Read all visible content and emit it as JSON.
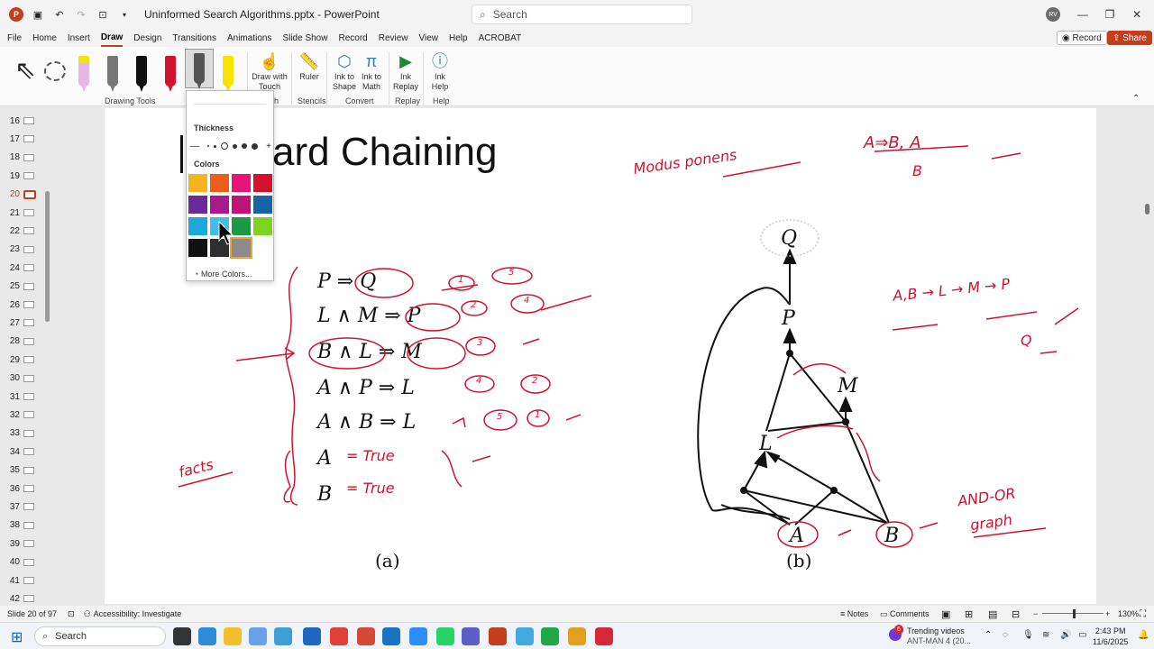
{
  "window": {
    "app_logo": "P",
    "title": "Uninformed Search Algorithms.pptx  -  PowerPoint",
    "search_placeholder": "Search",
    "user_initials": "RV"
  },
  "menu": {
    "tabs": [
      "File",
      "Home",
      "Insert",
      "Draw",
      "Design",
      "Transitions",
      "Animations",
      "Slide Show",
      "Record",
      "Review",
      "View",
      "Help",
      "ACROBAT"
    ],
    "active": "Draw",
    "record_label": "Record",
    "share_label": "Share"
  },
  "ribbon": {
    "draw_with_touch": "Draw with Touch",
    "ruler": "Ruler",
    "ink_to_shape": "Ink to Shape",
    "ink_to_math": "Ink to Math",
    "ink_replay": "Ink Replay",
    "ink_help": "Ink Help",
    "groups": {
      "drawing_tools": "Drawing Tools",
      "touch": "h",
      "stencils": "Stencils",
      "convert": "Convert",
      "replay": "Replay",
      "help": "Help"
    },
    "pen_colors": [
      "#e6b6e6",
      "#777777",
      "#111111",
      "#d0122f",
      "#555555",
      "#f4e400"
    ]
  },
  "popup": {
    "thickness_label": "Thickness",
    "colors_label": "Colors",
    "more_colors": "More Colors...",
    "swatches": [
      "#f5b324",
      "#ec5f1a",
      "#e8137b",
      "#d5122d",
      "#6a2b9a",
      "#a51a8e",
      "#c0137a",
      "#1663a6",
      "#1ba9d9",
      "#41bde8",
      "#199a45",
      "#7ed321",
      "#111111",
      "#2f2f2f",
      "#8c8c8c"
    ],
    "selected_index": 14
  },
  "thumbnails": [
    "16",
    "17",
    "18",
    "19",
    "20",
    "21",
    "22",
    "23",
    "24",
    "25",
    "26",
    "27",
    "28",
    "29",
    "30",
    "31",
    "32",
    "33",
    "34",
    "35",
    "36",
    "37",
    "38",
    "39",
    "40",
    "41",
    "42"
  ],
  "selected_slide": "20",
  "slide": {
    "title": "ard Chaining",
    "rules": [
      "P ⇒ Q",
      "L ∧ M ⇒ P",
      "B ∧ L ⇒ M",
      "A ∧ P ⇒ L",
      "A ∧ B ⇒ L",
      "A",
      "B"
    ],
    "caption_a": "(a)",
    "caption_b": "(b)",
    "nodes": [
      "Q",
      "P",
      "M",
      "L",
      "A",
      "B"
    ],
    "ink": {
      "modus_ponens": "Modus ponens",
      "inference": "A⇒B, A",
      "inference_result": "B",
      "facts": "facts",
      "true1": "= True",
      "true2": "= True",
      "chain": "A,B → L → M → P",
      "chain_result": "Q",
      "and_or": "AND-OR",
      "graph": "graph",
      "circle_nums": [
        "1",
        "5",
        "2",
        "4",
        "3",
        "4",
        "2",
        "5",
        "1"
      ]
    }
  },
  "status": {
    "slide_info": "Slide 20 of 97",
    "accessibility": "Accessibility: Investigate",
    "notes": "Notes",
    "comments": "Comments",
    "zoom": "130%"
  },
  "taskbar": {
    "search_placeholder": "Search",
    "news_title": "Trending videos",
    "news_sub": "ANT-MAN 4 (20...",
    "news_badge": "6",
    "time": "2:43 PM",
    "date": "11/6/2025"
  }
}
